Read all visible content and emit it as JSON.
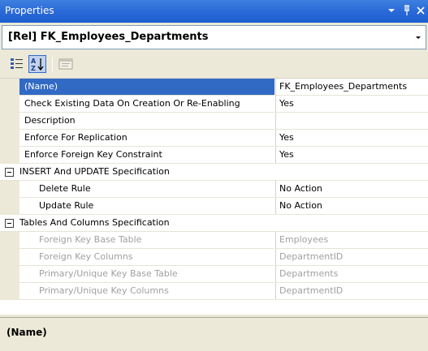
{
  "window": {
    "title": "Properties",
    "dropdown_icon": "chevron-down-icon",
    "pin_icon": "pin-icon",
    "close_icon": "close-icon",
    "pin_glyph": "I",
    "close_glyph": "✕"
  },
  "selector": {
    "value": "[Rel] FK_Employees_Departments"
  },
  "toolbar": {
    "items": [
      {
        "icon": "categorized-icon",
        "active": false
      },
      {
        "icon": "alphabetical-sort-icon",
        "active": true
      },
      {
        "icon": "property-pages-icon",
        "active": false
      }
    ]
  },
  "grid": {
    "rows": [
      {
        "name": "(Name)",
        "value": "FK_Employees_Departments"
      },
      {
        "name": "Check Existing Data On Creation Or Re-Enabling",
        "value": "Yes"
      },
      {
        "name": "Description",
        "value": ""
      },
      {
        "name": "Enforce For Replication",
        "value": "Yes"
      },
      {
        "name": "Enforce Foreign Key Constraint",
        "value": "Yes"
      },
      {
        "name": "INSERT And UPDATE Specification",
        "value": ""
      },
      {
        "name": "Delete Rule",
        "value": "No Action"
      },
      {
        "name": "Update Rule",
        "value": "No Action"
      },
      {
        "name": "Tables And Columns Specification",
        "value": ""
      },
      {
        "name": "Foreign Key Base Table",
        "value": "Employees"
      },
      {
        "name": "Foreign Key Columns",
        "value": "DepartmentID"
      },
      {
        "name": "Primary/Unique Key Base Table",
        "value": "Departments"
      },
      {
        "name": "Primary/Unique Key Columns",
        "value": "DepartmentID"
      }
    ]
  },
  "description": {
    "title": "(Name)"
  }
}
